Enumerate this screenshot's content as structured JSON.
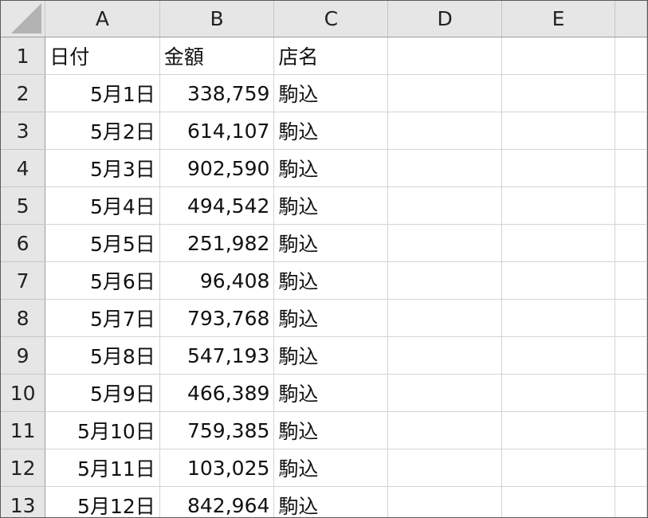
{
  "columns": [
    "A",
    "B",
    "C",
    "D",
    "E"
  ],
  "rows": [
    {
      "num": "1",
      "a": "日付",
      "b": "金額",
      "c": "店名"
    },
    {
      "num": "2",
      "a": "5月1日",
      "b": "338,759",
      "c": "駒込"
    },
    {
      "num": "3",
      "a": "5月2日",
      "b": "614,107",
      "c": "駒込"
    },
    {
      "num": "4",
      "a": "5月3日",
      "b": "902,590",
      "c": "駒込"
    },
    {
      "num": "5",
      "a": "5月4日",
      "b": "494,542",
      "c": "駒込"
    },
    {
      "num": "6",
      "a": "5月5日",
      "b": "251,982",
      "c": "駒込"
    },
    {
      "num": "7",
      "a": "5月6日",
      "b": "96,408",
      "c": "駒込"
    },
    {
      "num": "8",
      "a": "5月7日",
      "b": "793,768",
      "c": "駒込"
    },
    {
      "num": "9",
      "a": "5月8日",
      "b": "547,193",
      "c": "駒込"
    },
    {
      "num": "10",
      "a": "5月9日",
      "b": "466,389",
      "c": "駒込"
    },
    {
      "num": "11",
      "a": "5月10日",
      "b": "759,385",
      "c": "駒込"
    },
    {
      "num": "12",
      "a": "5月11日",
      "b": "103,025",
      "c": "駒込"
    },
    {
      "num": "13",
      "a": "5月12日",
      "b": "842,964",
      "c": "駒込"
    }
  ]
}
